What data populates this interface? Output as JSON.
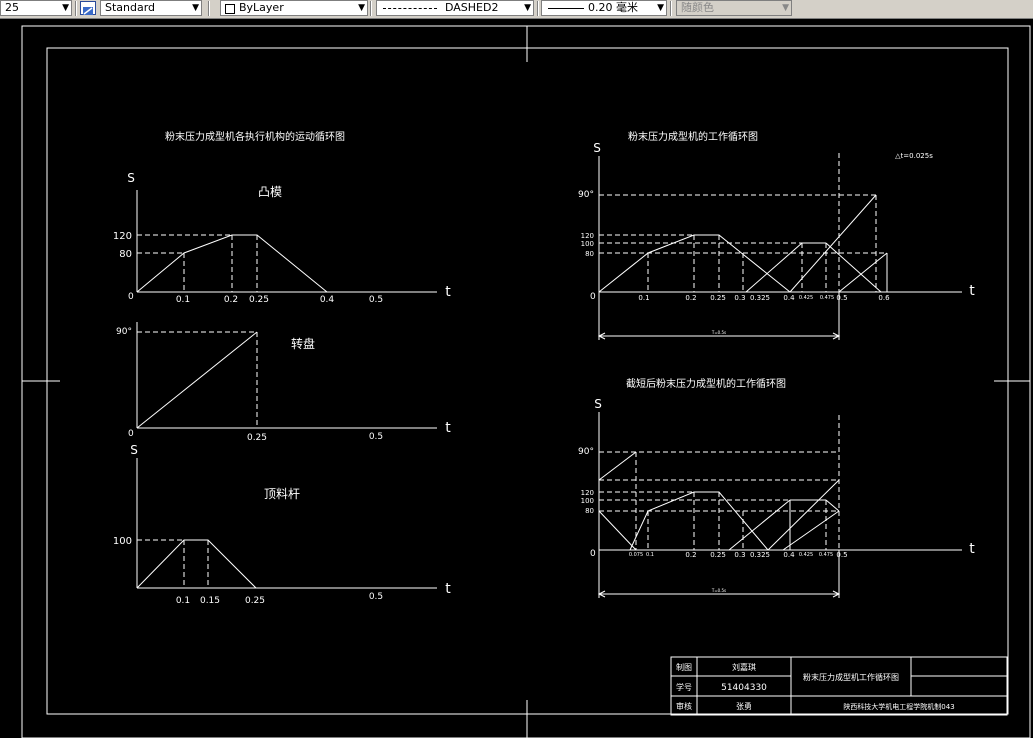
{
  "toolbar": {
    "scale_value": "25",
    "text_style_value": "Standard",
    "layer_value": "ByLayer",
    "linetype_value": "DASHED2",
    "lineweight_value": "0.20 毫米",
    "color_value": "随颜色"
  },
  "left": {
    "title": "粉末压力成型机各执行机构的运动循环图",
    "c1": {
      "label": "凸模",
      "s_axis": "S",
      "t_axis": "t",
      "origin": "0",
      "yticks": [
        "80",
        "120"
      ],
      "xticks": [
        "0.1",
        "0.2",
        "0.25",
        "0.4",
        "0.5"
      ]
    },
    "c2": {
      "label": "转盘",
      "t_axis": "t",
      "origin": "0",
      "yticks": [
        "90°"
      ],
      "xticks": [
        "0.25",
        "0.5"
      ]
    },
    "c3": {
      "label": "顶料杆",
      "s_axis": "S",
      "t_axis": "t",
      "yticks": [
        "100"
      ],
      "xticks": [
        "0.1",
        "0.15",
        "0.25",
        "0.5"
      ]
    }
  },
  "right": {
    "top": {
      "title": "粉末压力成型机的工作循环图",
      "s_axis": "S",
      "t_axis": "t",
      "origin": "0",
      "note": "△t=0.025s",
      "yticks": [
        "90°",
        "120",
        "100",
        "80"
      ],
      "xticks": [
        "0.1",
        "0.2",
        "0.25",
        "0.3",
        "0.325",
        "0.4",
        "0.425",
        "0.475",
        "0.5",
        "0.6"
      ],
      "dim_label": "T=0.5s"
    },
    "bottom": {
      "title": "截短后粉末压力成型机的工作循环图",
      "s_axis": "S",
      "t_axis": "t",
      "origin": "0",
      "yticks": [
        "90°",
        "120",
        "100",
        "80"
      ],
      "xticks": [
        "0.075",
        "0.1",
        "0.2",
        "0.25",
        "0.3",
        "0.325",
        "0.4",
        "0.425",
        "0.475",
        "0.5"
      ],
      "dim_label": "T=0.5s"
    }
  },
  "title_block": {
    "r1c1": "制图",
    "r1c2": "刘嘉琪",
    "r2c1": "学号",
    "r2c2": "51404330",
    "r3c1": "审核",
    "r3c2": "张勇",
    "drawing_title": "粉末压力成型机工作循环图",
    "school": "陕西科技大学机电工程学院机制043"
  }
}
